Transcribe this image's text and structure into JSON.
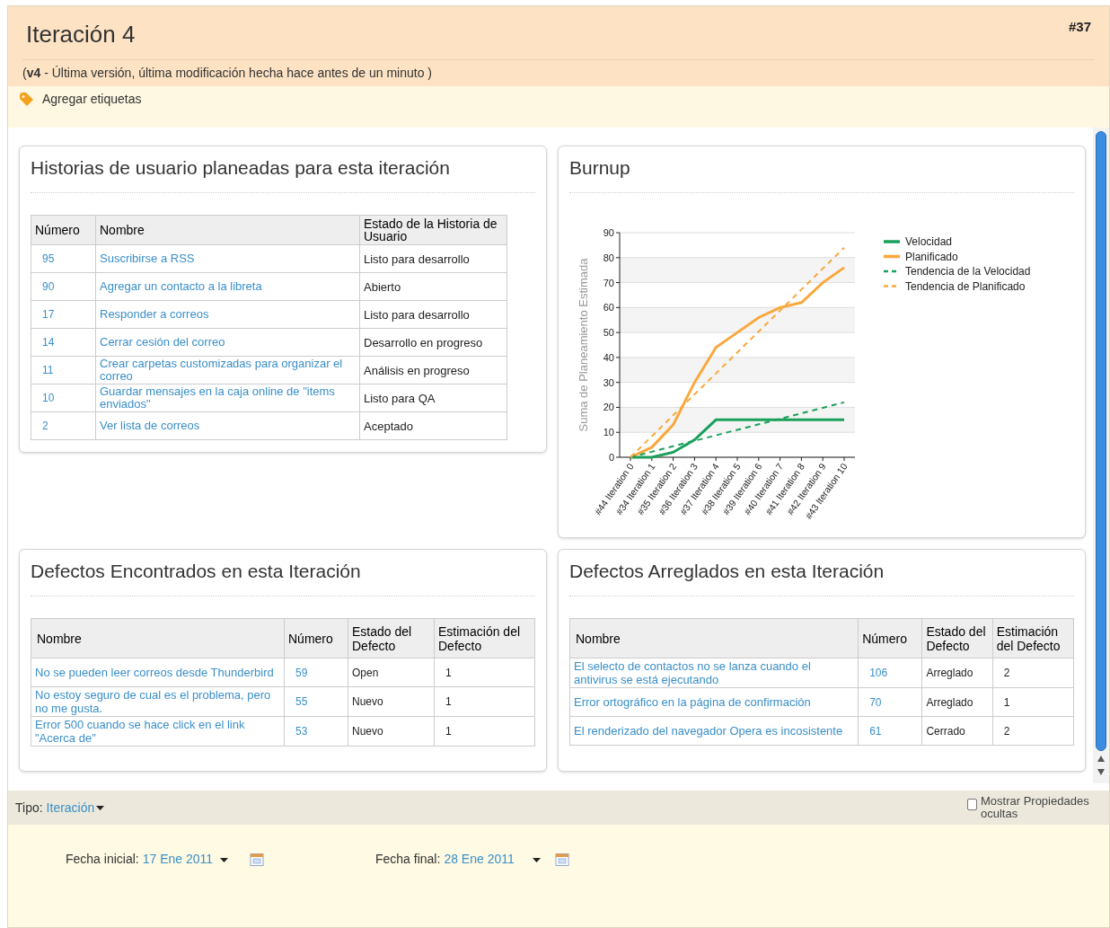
{
  "header": {
    "title": "Iteración 4",
    "number": "#37",
    "subtitle": "(**v4** - Última versión, última modificación hecha hace antes de un minuto )"
  },
  "tags": {
    "label": "Agregar etiquetas"
  },
  "stories_panel": {
    "title": "Historias de usuario planeadas para esta iteración",
    "columns": [
      "Número",
      "Nombre",
      "Estado de la Historia de Usuario"
    ],
    "rows": [
      {
        "number": "95",
        "name": "Suscribirse a RSS",
        "status": "Listo para desarrollo"
      },
      {
        "number": "90",
        "name": "Agregar un contacto a la libreta",
        "status": "Abierto"
      },
      {
        "number": "17",
        "name": "Responder a correos",
        "status": "Listo para desarrollo"
      },
      {
        "number": "14",
        "name": "Cerrar cesión del correo",
        "status": "Desarrollo en progreso"
      },
      {
        "number": "11",
        "name": "Crear carpetas customizadas para organizar el correo",
        "status": "Análisis en progreso"
      },
      {
        "number": "10",
        "name": "Guardar mensajes en la caja online de \"items enviados\"",
        "status": "Listo para QA"
      },
      {
        "number": "2",
        "name": "Ver lista de correos",
        "status": "Aceptado"
      }
    ]
  },
  "burnup_panel": {
    "title": "Burnup",
    "chart_data": {
      "type": "line",
      "grid": true,
      "legend": true,
      "ylabel": "Suma de Planeamiento Estimada",
      "categories": [
        "#44 Iteration 0",
        "#34 Iteration 1",
        "#35 Iteration 2",
        "#36 Iteration 3",
        "#37 Iteration 4",
        "#38 Iteration 5",
        "#39 Iteration 6",
        "#40 Iteration 7",
        "#41 Iteration 8",
        "#42 Iteration 9",
        "#43 Iteration 10"
      ],
      "ylim": [
        0,
        90
      ],
      "yticks": [
        {
          "value": 0,
          "label": "0"
        },
        {
          "value": 10,
          "label": "10"
        },
        {
          "value": 20,
          "label": "20"
        },
        {
          "value": 30,
          "label": "30"
        },
        {
          "value": 40,
          "label": "40"
        },
        {
          "value": 50,
          "label": "50"
        },
        {
          "value": 60,
          "label": "60"
        },
        {
          "value": 70,
          "label": "70"
        },
        {
          "value": 80,
          "label": "80"
        },
        {
          "value": 90,
          "label": "90"
        }
      ],
      "series": [
        {
          "name": "Velocidad",
          "color": "#1aa05a",
          "line_style": "solid",
          "values": [
            0,
            0,
            2,
            7,
            15,
            15,
            15,
            15,
            15,
            15,
            15
          ]
        },
        {
          "name": "Planificado",
          "color": "#f9a83c",
          "line_style": "solid",
          "values": [
            0,
            4,
            13,
            30,
            44,
            50,
            56,
            60,
            62,
            70,
            76
          ]
        },
        {
          "name": "Tendencia de la Velocidad",
          "color": "#1aa05a",
          "line_style": "dashed",
          "values": [
            0,
            2.2,
            4.4,
            6.6,
            8.8,
            11,
            13.2,
            15.4,
            17.6,
            19.8,
            22
          ]
        },
        {
          "name": "Tendencia de Planificado",
          "color": "#f9a83c",
          "line_style": "dashed",
          "values": [
            0,
            8.4,
            16.8,
            25.2,
            33.6,
            42,
            50.4,
            58.8,
            67.2,
            75.6,
            84
          ]
        }
      ]
    }
  },
  "found_defects": {
    "title": "Defectos Encontrados en esta Iteración",
    "columns": [
      "Nombre",
      "Número",
      "Estado del Defecto",
      "Estimación del Defecto"
    ],
    "rows": [
      {
        "name": "No se pueden leer correos desde Thunderbird",
        "number": "59",
        "status": "Open",
        "estimate": "1"
      },
      {
        "name": "No estoy seguro de cual es el problema, pero no me gusta.",
        "number": "55",
        "status": "Nuevo",
        "estimate": "1"
      },
      {
        "name": "Error 500 cuando se hace click en el link \"Acerca de\"",
        "number": "53",
        "status": "Nuevo",
        "estimate": "1"
      }
    ]
  },
  "fixed_defects": {
    "title": "Defectos Arreglados en esta Iteración",
    "columns": [
      "Nombre",
      "Número",
      "Estado del Defecto",
      "Estimación del Defecto"
    ],
    "rows": [
      {
        "name": "El selecto de contactos no se lanza cuando el antivirus se está ejecutando",
        "number": "106",
        "status": "Arreglado",
        "estimate": "2"
      },
      {
        "name": "Error ortográfico en la página de confirmación",
        "number": "70",
        "status": "Arreglado",
        "estimate": "1"
      },
      {
        "name": "El renderizado del navegador Opera es incosistente",
        "number": "61",
        "status": "Cerrado",
        "estimate": "2"
      }
    ]
  },
  "footer": {
    "type_label": "Tipo:",
    "type_value": "Iteración",
    "show_hidden": {
      "label": "Mostrar Propiedades ocultas",
      "checked": false
    },
    "start_label": "Fecha inicial:",
    "start_value": "17 Ene 2011",
    "end_label": "Fecha final:",
    "end_value": "28 Ene 2011"
  }
}
